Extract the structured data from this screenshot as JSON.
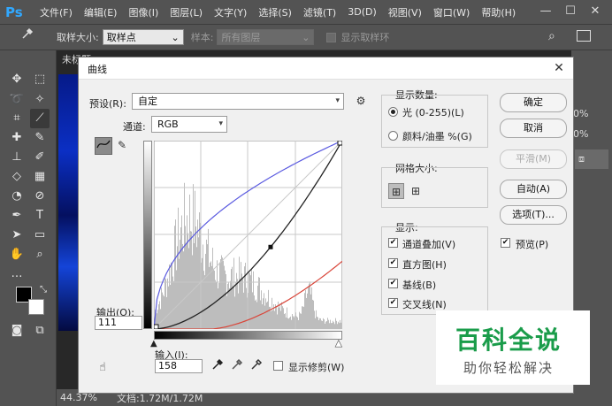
{
  "app": {
    "logo": "Ps"
  },
  "menu": [
    "文件(F)",
    "编辑(E)",
    "图像(I)",
    "图层(L)",
    "文字(Y)",
    "选择(S)",
    "滤镜(T)",
    "3D(D)",
    "视图(V)",
    "窗口(W)",
    "帮助(H)"
  ],
  "window_controls": {
    "minimize": "—",
    "restore": "☐",
    "close": "✕"
  },
  "options_bar": {
    "sample_size_label": "取样大小:",
    "sample_size_value": "取样点",
    "sample_label": "样本:",
    "sample_value": "所有图层",
    "show_ring_label": "显示取样环"
  },
  "document": {
    "tab_title": "未标题",
    "zoom": "44.37%",
    "doc_info": "文档:1.72M/1.72M"
  },
  "side_panel": {
    "opacity_top": "0%",
    "opacity_bottom": "0%"
  },
  "dialog": {
    "title": "曲线",
    "preset_label": "预设(R):",
    "preset_value": "自定",
    "channel_label": "通道:",
    "channel_value": "RGB",
    "output_label": "输出(O):",
    "output_value": "111",
    "input_label": "输入(I):",
    "input_value": "158",
    "show_clipping_label": "显示修剪(W)",
    "show_amount": {
      "title": "显示数量:",
      "light_label": "光 (0-255)(L)",
      "pigment_label": "颜料/油墨 %(G)",
      "selected": "light"
    },
    "grid_size": {
      "title": "网格大小:"
    },
    "show": {
      "title": "显示:",
      "channel_overlays": "通道叠加(V)",
      "histogram": "直方图(H)",
      "baseline": "基线(B)",
      "intersection_line": "交叉线(N)"
    },
    "buttons": {
      "ok": "确定",
      "cancel": "取消",
      "smooth": "平滑(M)",
      "auto": "自动(A)",
      "options": "选项(T)..."
    },
    "preview_label": "预览(P)"
  },
  "watermark": {
    "big": "百科全说",
    "small": "助你轻松解决"
  },
  "colors": {
    "rgb_curve": "#222222",
    "blue_curve": "#5a5ae0",
    "red_curve": "#d9463a",
    "histogram": "#bdbdbd",
    "watermark_green": "#1a9c4a"
  }
}
